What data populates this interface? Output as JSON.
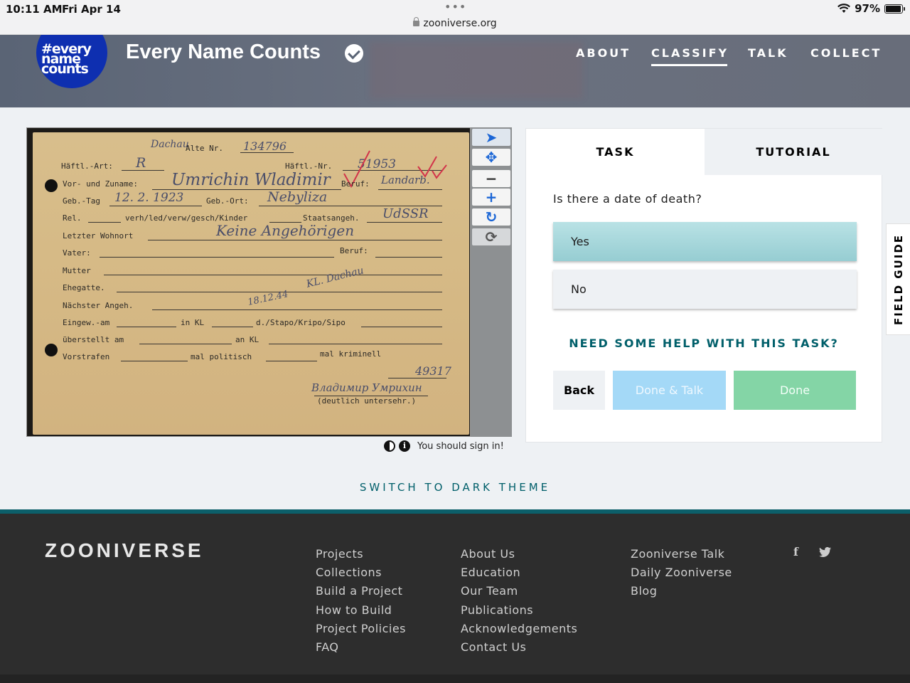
{
  "status_bar": {
    "time": "10:11 AM",
    "date": "Fri Apr 14",
    "dots": "•••",
    "url": "zooniverse.org",
    "battery": "97%",
    "battery_level": 0.97
  },
  "project": {
    "logo_lines": [
      "#every",
      "name",
      "counts"
    ],
    "title": "Every Name Counts",
    "nav": [
      {
        "label": "ABOUT",
        "active": false
      },
      {
        "label": "CLASSIFY",
        "active": true
      },
      {
        "label": "TALK",
        "active": false
      },
      {
        "label": "COLLECT",
        "active": false
      }
    ]
  },
  "card": {
    "printed": {
      "alte_nr": "Alte Nr.",
      "haftl_art": "Häftl.-Art:",
      "haftl_nr": "Häftl.-Nr.",
      "vor_zuname": "Vor- und Zuname:",
      "beruf": "Beruf:",
      "geb_tag": "Geb.-Tag",
      "geb_ort": "Geb.-Ort:",
      "rel": "Rel.",
      "verh": "verh/led/verw/gesch/Kinder",
      "staatsangeh": "Staatsangeh.",
      "letzter_wohnort": "Letzter Wohnort",
      "vater": "Vater:",
      "beruf2": "Beruf:",
      "mutter": "Mutter",
      "ehegatte": "Ehegatte.",
      "nachster": "Nächster Angeh.",
      "eingew": "Eingew.-am",
      "in_kl": "in KL",
      "stapo": "d./Stapo/Kripo/Sipo",
      "uberstellt": "überstellt am",
      "an_kl": "an KL",
      "vorstrafen": "Vorstrafen",
      "mal_politisch": "mal politisch",
      "mal_kriminell": "mal kriminell",
      "deutlich": "(deutlich untersehr.)"
    },
    "handwritten": {
      "dachau": "Dachau",
      "alte_nr_val": "134796",
      "art": "R",
      "haftl_nr_val": "51953",
      "name": "Umrichin Wladimir",
      "beruf_val": "Landarb.",
      "geb_tag_val": "12. 2. 1923",
      "geb_ort_val": "Nebyliza",
      "staat_val": "UdSSR",
      "wohnort_val": "Keine Angehörigen",
      "kl_dachau": "KL. Dachau",
      "date_stamp": "18.12.44",
      "num": "49317",
      "signature": "Владимир Умрихин"
    }
  },
  "toolbar": {
    "tools": [
      {
        "name": "pointer-icon",
        "glyph": "➤"
      },
      {
        "name": "move-icon",
        "glyph": "✥"
      },
      {
        "name": "zoom-out-icon",
        "glyph": "−"
      },
      {
        "name": "zoom-in-icon",
        "glyph": "+"
      },
      {
        "name": "rotate-icon",
        "glyph": "↻"
      },
      {
        "name": "reset-icon",
        "glyph": "⟳"
      }
    ]
  },
  "viewer_footer": {
    "signin_text": "You should sign in!",
    "info_glyph": "i"
  },
  "task_panel": {
    "tab_task": "TASK",
    "tab_tutorial": "TUTORIAL",
    "question": "Is there a date of death?",
    "answers": [
      "Yes",
      "No"
    ],
    "help": "NEED SOME HELP WITH THIS TASK?",
    "back": "Back",
    "done_talk": "Done & Talk",
    "done": "Done"
  },
  "field_guide": "FIELD GUIDE",
  "switch_theme": "SWITCH TO DARK THEME",
  "footer": {
    "logo": "ZOONIVERSE",
    "col1": [
      "Projects",
      "Collections",
      "Build a Project",
      "How to Build",
      "Project Policies",
      "FAQ"
    ],
    "col2": [
      "About Us",
      "Education",
      "Our Team",
      "Publications",
      "Acknowledgements",
      "Contact Us"
    ],
    "col3": [
      "Zooniverse Talk",
      "Daily Zooniverse",
      "Blog"
    ],
    "social": [
      "f",
      "t"
    ]
  },
  "colors": {
    "accent_teal": "#005f6a",
    "yes_answer": "#96cdd2",
    "done_green": "#84d5a6",
    "done_talk_blue": "#a4d9f7",
    "logo_blue": "#0e2fb0",
    "tool_blue": "#1b66d6"
  }
}
